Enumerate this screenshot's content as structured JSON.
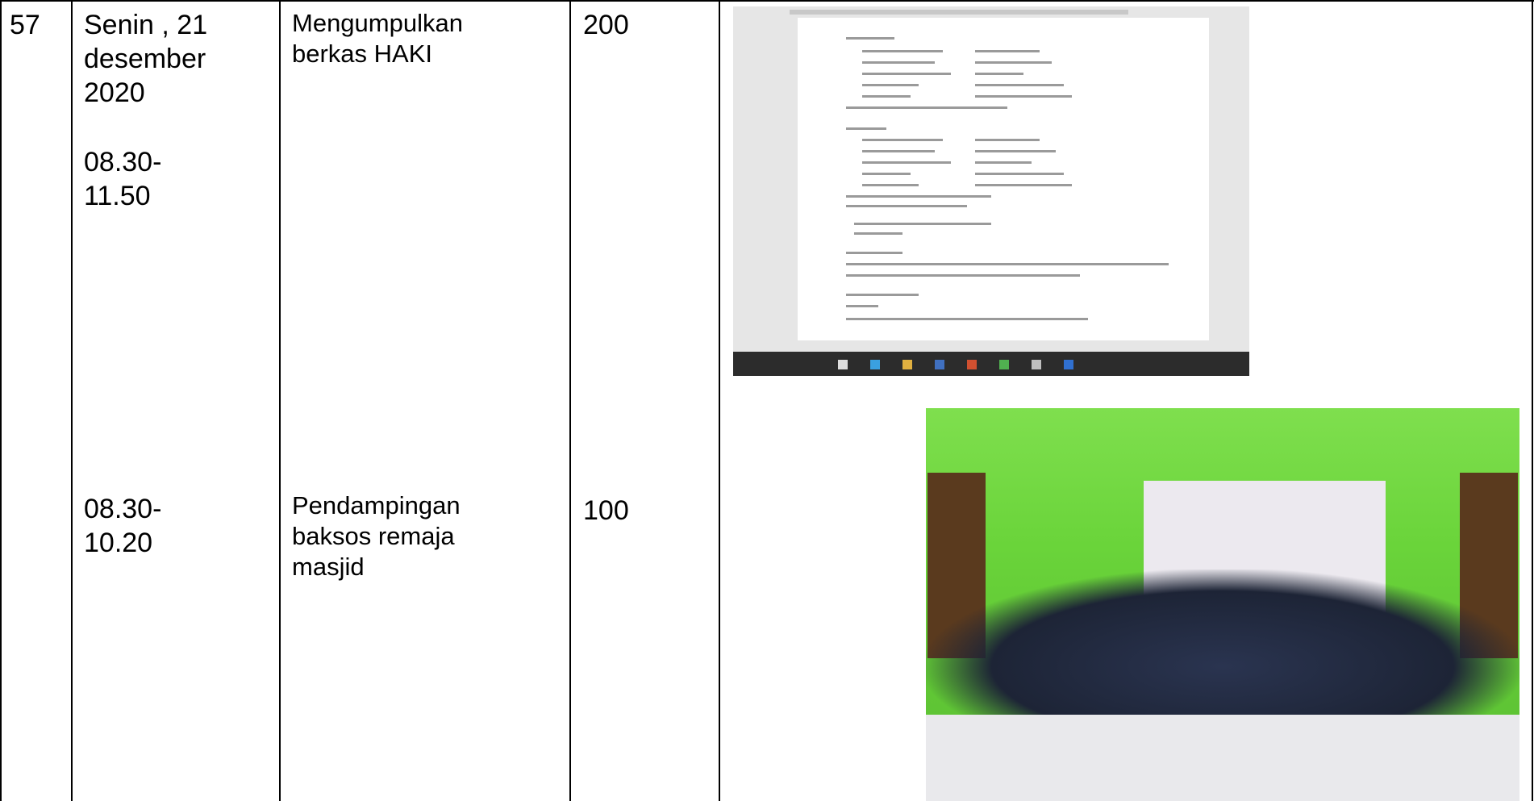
{
  "row": {
    "number": "57",
    "date_lines": "Senin , 21\ndesember\n2020",
    "entries": [
      {
        "time": "08.30-\n11.50",
        "activity": "Mengumpulkan\nberkas HAKI",
        "value": "200"
      },
      {
        "time": "08.30-\n10.20",
        "activity": "Pendampingan\nbaksos remaja\nmasjid",
        "value": "100"
      }
    ]
  },
  "images": [
    {
      "kind": "screenshot",
      "depicts": "document-window-screenshot"
    },
    {
      "kind": "photo",
      "depicts": "group-photo"
    }
  ]
}
